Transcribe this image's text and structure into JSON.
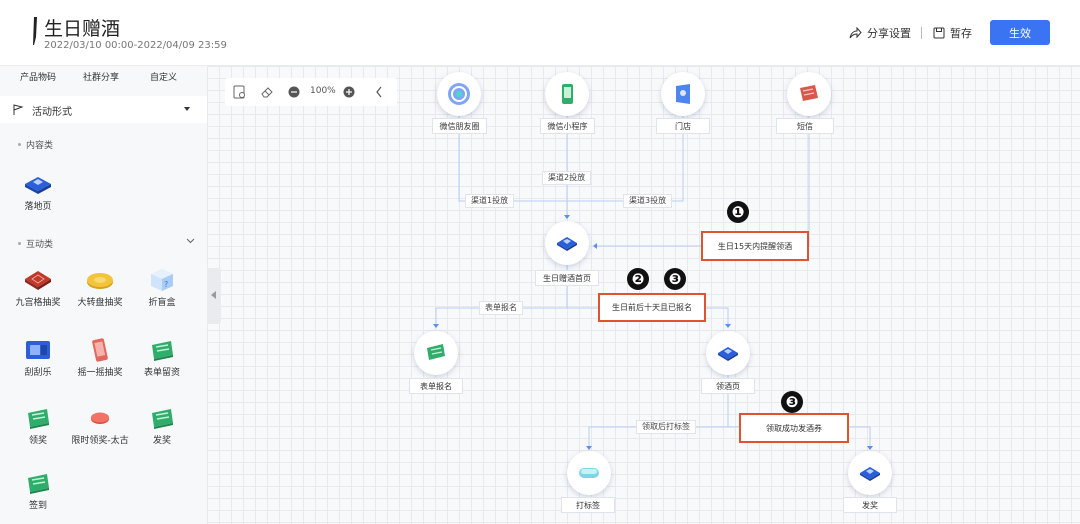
{
  "header": {
    "title": "生日赠酒",
    "date_range": "2022/03/10 00:00-2022/04/09 23:59",
    "share_settings": "分享设置",
    "save_draft": "暂存",
    "publish": "生效"
  },
  "sidebar": {
    "tabs": [
      "产品物码",
      "社群分享",
      "自定义"
    ],
    "activity_form": "活动形式",
    "content_section": "内容类",
    "interactive_section": "互动类",
    "content_items": [
      {
        "label": "落地页",
        "icon": "landing-page-icon"
      }
    ],
    "interactive_items": [
      {
        "label": "九宫格抽奖",
        "icon": "grid-lottery-icon"
      },
      {
        "label": "大转盘抽奖",
        "icon": "wheel-lottery-icon"
      },
      {
        "label": "折盲盒",
        "icon": "blind-box-icon"
      },
      {
        "label": "刮刮乐",
        "icon": "scratch-card-icon"
      },
      {
        "label": "摇一摇抽奖",
        "icon": "shake-lottery-icon"
      },
      {
        "label": "表单留资",
        "icon": "form-lead-icon"
      },
      {
        "label": "领奖",
        "icon": "claim-prize-icon"
      },
      {
        "label": "限时领奖-太古",
        "icon": "timed-claim-icon"
      },
      {
        "label": "发奖",
        "icon": "give-prize-icon"
      },
      {
        "label": "签到",
        "icon": "check-in-icon"
      }
    ]
  },
  "canvas": {
    "zoom": "100%",
    "nodes": {
      "moments": "微信朋友圈",
      "mini_program": "微信小程序",
      "store": "门店",
      "sms": "短信",
      "home": "生日赠酒首页",
      "form": "表单报名",
      "claim_page": "领酒页",
      "tag": "打标签",
      "give": "发奖"
    },
    "edges": {
      "ch1": "渠道1投放",
      "ch2": "渠道2投放",
      "ch3": "渠道3投放",
      "form_signup": "表单报名",
      "tag_after_claim": "领取后打标签"
    },
    "conditions": {
      "remind": "生日15天内提醒领酒",
      "before_after": "生日前后十天且已报名",
      "success": "领取成功发酒券"
    },
    "badges": [
      "❶",
      "❷",
      "❸",
      "❸"
    ]
  },
  "colors": {
    "primary": "#3b74f3",
    "highlight": "#e0532e",
    "badge": "#111111"
  }
}
